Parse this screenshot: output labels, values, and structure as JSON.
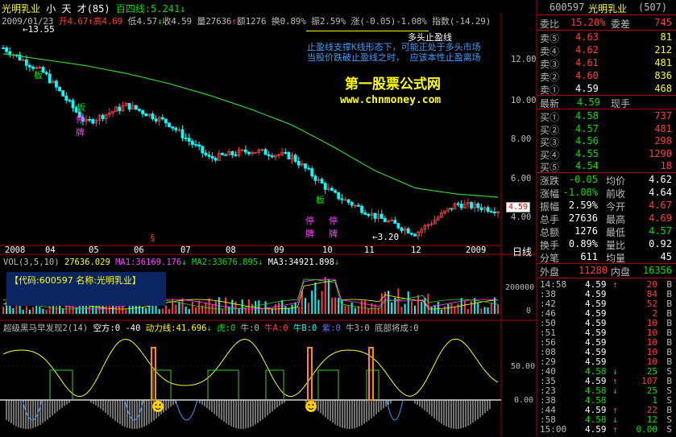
{
  "header": {
    "stock": "光明乳业",
    "period": "小 天 才(85)",
    "ma_label": "百四线:5.241",
    "date": "2009/01/23",
    "open": "开4.67",
    "high": "高4.69",
    "low": "低4.57",
    "close": "收4.59",
    "volume": "量27636",
    "amount": "额1276",
    "turnover": "换0.89%",
    "amplitude": "振2.59%",
    "change": "涨(-0.05)-1.08%",
    "index": "指数(-14.29)"
  },
  "annotations": {
    "max_price": "13.55",
    "min_price": "3.20",
    "s_mark": "§",
    "signal_board": "板",
    "signal_stop": "停牌",
    "legend_line1": "多头止盈线",
    "legend_line2": "止盈线支撑K线形态下，可能正处于多头市场",
    "legend_line3": "当股价跌破止盈线之时，  应该本性止盈离场",
    "brand_cn": "第一股票公式网",
    "brand_url": "www.chnmoney.com",
    "current_price_tag": "4.59",
    "period_label": "日线"
  },
  "axis": {
    "x_labels": [
      "2008",
      "04",
      "05",
      "06",
      "07",
      "08",
      "09",
      "10",
      "11",
      "12",
      "2009"
    ],
    "y_labels": [
      "12.00",
      "10.00",
      "8.00",
      "6.00",
      "4.00"
    ]
  },
  "volume_panel": {
    "title": "VOL(3,5,10)",
    "vol": "27636.029",
    "ma1": "MA1:36169.176",
    "ma2": "MA2:33676.895",
    "ma3": "MA3:34921.898",
    "code_box": "【代码:600597 名称:光明乳业】",
    "y_labels": [
      "200000",
      "0"
    ]
  },
  "indicator_panel": {
    "title": "超级黑马早发现2(14)",
    "kong": "空方:0",
    "kong_val": "-40",
    "power": "动力线:41.696",
    "tiger": "虎:0",
    "niu": "牛:0",
    "niu_a": "牛A:0",
    "niu_b": "牛B:0",
    "zi": "紫:0",
    "niu3": "牛3:0",
    "bottom": "底部将成:0",
    "y_labels": [
      "50.00",
      "0.00"
    ]
  },
  "right_panel": {
    "code": "600597",
    "name": "光明乳业",
    "num": "(507)",
    "weibi_label": "委比",
    "weibi": "15.20%",
    "weicha_label": "委差",
    "weicha": "745",
    "sells": [
      {
        "label": "卖⑤",
        "price": "4.63",
        "vol": "81"
      },
      {
        "label": "卖④",
        "price": "4.62",
        "vol": "212"
      },
      {
        "label": "卖③",
        "price": "4.61",
        "vol": "481"
      },
      {
        "label": "卖②",
        "price": "4.60",
        "vol": "836"
      },
      {
        "label": "卖①",
        "price": "4.59",
        "vol": "468"
      }
    ],
    "latest_label": "最新",
    "latest": "4.59",
    "xianshou_label": "现手",
    "buys": [
      {
        "label": "买①",
        "price": "4.58",
        "vol": "737"
      },
      {
        "label": "买②",
        "price": "4.57",
        "vol": "481"
      },
      {
        "label": "买③",
        "price": "4.56",
        "vol": "298"
      },
      {
        "label": "买④",
        "price": "4.55",
        "vol": "1290"
      },
      {
        "label": "买⑤",
        "price": "4.54",
        "vol": "18"
      }
    ],
    "stats": [
      {
        "l1": "涨跌",
        "v1": "-0.05",
        "l2": "均价",
        "v2": "4.62",
        "c1": "grn",
        "c2": "wht"
      },
      {
        "l1": "涨幅",
        "v1": "-1.08%",
        "l2": "前收",
        "v2": "4.64",
        "c1": "grn",
        "c2": "wht"
      },
      {
        "l1": "振幅",
        "v1": "2.59%",
        "l2": "今开",
        "v2": "4.67",
        "c1": "wht",
        "c2": "red"
      },
      {
        "l1": "总手",
        "v1": "27636",
        "l2": "最高",
        "v2": "4.69",
        "c1": "wht",
        "c2": "red"
      },
      {
        "l1": "总额",
        "v1": "1276",
        "l2": "最低",
        "v2": "4.57",
        "c1": "wht",
        "c2": "grn"
      },
      {
        "l1": "换手",
        "v1": "0.89%",
        "l2": "量比",
        "v2": "0.92",
        "c1": "wht",
        "c2": "wht"
      },
      {
        "l1": "分笔",
        "v1": "611",
        "l2": "均量",
        "v2": "45",
        "c1": "wht",
        "c2": "wht"
      }
    ],
    "waipan_label": "外盘",
    "waipan": "11280",
    "neipan_label": "内盘",
    "neipan": "16356",
    "ticks": [
      {
        "t": "14:58",
        "p": "4.59",
        "a": "↑",
        "v": "20",
        "s": "B"
      },
      {
        "t": ":38",
        "p": "4.59",
        "a": "",
        "v": "84",
        "s": "B"
      },
      {
        "t": ":42",
        "p": "4.59",
        "a": "",
        "v": "52",
        "s": "B"
      },
      {
        "t": ":46",
        "p": "4.59",
        "a": "",
        "v": "2",
        "s": "B"
      },
      {
        "t": ":50",
        "p": "4.59",
        "a": "",
        "v": "10",
        "s": "B"
      },
      {
        "t": ":51",
        "p": "4.59",
        "a": "",
        "v": "10",
        "s": "B"
      },
      {
        "t": ":56",
        "p": "4.59",
        "a": "",
        "v": "10",
        "s": "B"
      },
      {
        "t": ":08",
        "p": "4.59",
        "a": "",
        "v": "10",
        "s": "B"
      },
      {
        "t": ":29",
        "p": "4.59",
        "a": "",
        "v": "10",
        "s": "B"
      },
      {
        "t": ":40",
        "p": "4.58",
        "a": "↓",
        "v": "25",
        "s": "S"
      },
      {
        "t": ":35",
        "p": "4.59",
        "a": "↑",
        "v": "107",
        "s": "B"
      },
      {
        "t": ":23",
        "p": "4.58",
        "a": "↓",
        "v": "25",
        "s": "S"
      },
      {
        "t": ":38",
        "p": "4.58",
        "a": "",
        "v": "1",
        "s": "S"
      },
      {
        "t": ":44",
        "p": "4.59",
        "a": "↑",
        "v": "22",
        "s": "B"
      },
      {
        "t": ":58",
        "p": "4.58",
        "a": "↓",
        "v": "12",
        "s": "S"
      },
      {
        "t": "15:00",
        "p": "4.59",
        "a": "↑",
        "v": "0.00",
        "s": "S"
      }
    ]
  },
  "chart_data": {
    "type": "line",
    "series_price": {
      "x": [
        "2008-01",
        "2008-02",
        "2008-03",
        "2008-04",
        "2008-05",
        "2008-06",
        "2008-07",
        "2008-08",
        "2008-09",
        "2008-10",
        "2008-11",
        "2008-12",
        "2009-01"
      ],
      "close": [
        12.8,
        11.5,
        9.0,
        9.9,
        9.0,
        7.2,
        7.6,
        7.3,
        5.4,
        4.3,
        3.4,
        4.9,
        4.59
      ]
    },
    "series_ma": {
      "name": "百四线",
      "values": [
        12.5,
        12.2,
        11.9,
        11.5,
        11.0,
        10.4,
        9.7,
        8.9,
        7.8,
        6.6,
        5.7,
        5.4,
        5.24
      ]
    },
    "ylim": [
      3.0,
      14.0
    ]
  }
}
